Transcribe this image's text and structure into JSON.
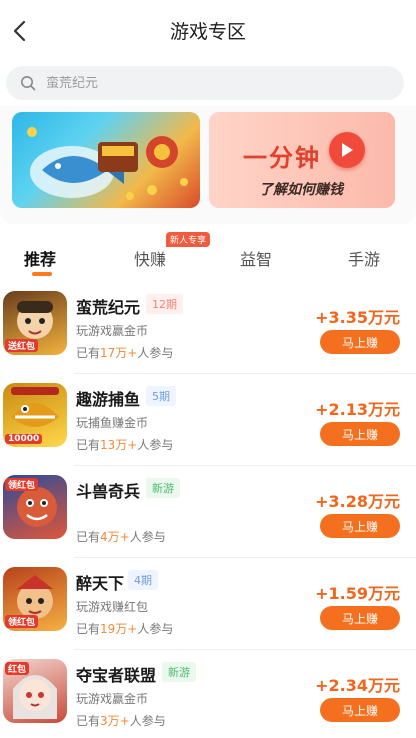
{
  "header": {
    "title": "游戏专区"
  },
  "search": {
    "placeholder": "蛮荒纪元"
  },
  "banner": {
    "earn_main": "一分钟",
    "earn_sub": "了解如何赚钱"
  },
  "tabs": [
    {
      "label": "推荐",
      "active": true
    },
    {
      "label": "快赚",
      "badge": "新人专享"
    },
    {
      "label": "益智"
    },
    {
      "label": "手游"
    }
  ],
  "games": [
    {
      "name": "蛮荒纪元",
      "tag": "12期",
      "tag_type": "period",
      "desc": "玩游戏赢金币",
      "joined_prefix": "已有",
      "joined_count": "17万+",
      "joined_suffix": "人参与",
      "reward": "+3.35万元",
      "button": "马上赚",
      "icon_label": "送红包",
      "icon": "game-icon-manhuang",
      "colors": [
        "#6a3d1e",
        "#f2b33d"
      ]
    },
    {
      "name": "趣游捕鱼",
      "tag": "5期",
      "tag_type": "period-blue",
      "desc": "玩捕鱼赚金币",
      "joined_prefix": "已有",
      "joined_count": "13万+",
      "joined_suffix": "人参与",
      "reward": "+2.13万元",
      "button": "马上赚",
      "icon_label": "10000",
      "icon": "game-icon-fishing",
      "colors": [
        "#c98a12",
        "#ffd84a"
      ]
    },
    {
      "name": "斗兽奇兵",
      "tag": "新游",
      "tag_type": "newgame",
      "desc": "",
      "joined_prefix": "已有",
      "joined_count": "4万+",
      "joined_suffix": "人参与",
      "reward": "+3.28万元",
      "button": "马上赚",
      "icon_label": "领红包",
      "icon": "game-icon-doushou",
      "colors": [
        "#2b4b9a",
        "#e0563a"
      ]
    },
    {
      "name": "醉天下",
      "tag": "4期",
      "tag_type": "period-blue",
      "desc": "玩游戏赚红包",
      "joined_prefix": "已有",
      "joined_count": "19万+",
      "joined_suffix": "人参与",
      "reward": "+1.59万元",
      "button": "马上赚",
      "icon_label": "领红包",
      "icon": "game-icon-zuitianxia",
      "colors": [
        "#b8421c",
        "#f5b143"
      ]
    },
    {
      "name": "夺宝者联盟",
      "tag": "新游",
      "tag_type": "newgame",
      "desc": "玩游戏赢金币",
      "joined_prefix": "已有",
      "joined_count": "3万+",
      "joined_suffix": "人参与",
      "reward": "+2.34万元",
      "button": "马上赚",
      "icon_label": "红包",
      "icon": "game-icon-duobao",
      "colors": [
        "#f3d6cf",
        "#c84a3a"
      ]
    }
  ]
}
